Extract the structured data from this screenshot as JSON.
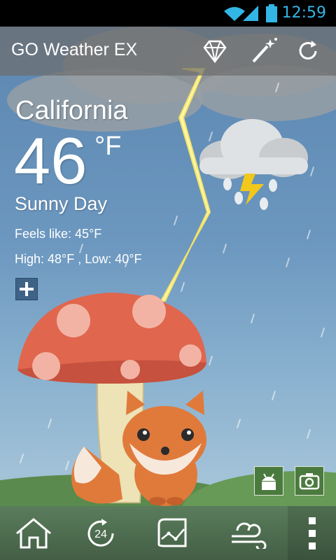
{
  "status_bar": {
    "time": "12:59"
  },
  "app": {
    "title": "GO Weather EX"
  },
  "toolbar": {
    "icons": [
      "diamond-icon",
      "magic-wand-icon",
      "refresh-icon"
    ]
  },
  "weather": {
    "city": "California",
    "temperature": "46",
    "unit": "°F",
    "condition": "Sunny Day",
    "feels_like": "Feels like: 45°F",
    "high_low": "High: 48°F , Low: 40°F"
  },
  "scene": {
    "weather_icon": "thunderstorm-icon"
  },
  "bottom_nav": {
    "icons": [
      "home-icon",
      "24-hour-icon",
      "trend-chart-icon",
      "wind-icon",
      "overflow-menu-icon"
    ]
  },
  "colors": {
    "status_accent": "#33b5e5",
    "sky": "#5b86b0",
    "grass": "#5a7d5c"
  }
}
